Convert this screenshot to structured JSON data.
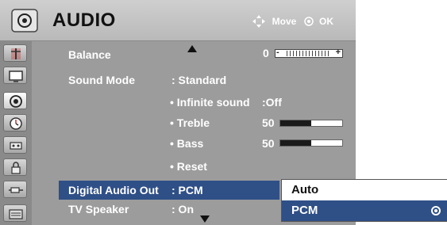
{
  "header": {
    "title": "AUDIO",
    "hint_move": "Move",
    "hint_ok": "OK",
    "header_icon": "speaker-icon"
  },
  "sidebar": {
    "items": [
      {
        "icon": "antenna-icon"
      },
      {
        "icon": "picture-icon"
      },
      {
        "icon": "audio-icon",
        "active": true
      },
      {
        "icon": "clock-icon"
      },
      {
        "icon": "option-icon"
      },
      {
        "icon": "lock-icon"
      },
      {
        "icon": "input-icon"
      },
      {
        "icon": "media-icon"
      }
    ]
  },
  "menu": {
    "balance": {
      "label": "Balance",
      "value": "0"
    },
    "sound_mode": {
      "label": "Sound Mode",
      "value": ": Standard"
    },
    "infinite_sound": {
      "label": "• Infinite sound",
      "value": ":Off"
    },
    "treble": {
      "label": "• Treble",
      "value": "50",
      "level": 0.5
    },
    "bass": {
      "label": "• Bass",
      "value": "50",
      "level": 0.5
    },
    "reset": {
      "label": "• Reset"
    },
    "digital_audio_out": {
      "label": "Digital Audio Out",
      "value": ": PCM"
    },
    "tv_speaker": {
      "label": "TV Speaker",
      "value": ": On"
    }
  },
  "dropdown": {
    "options": [
      {
        "label": "Auto",
        "selected": false
      },
      {
        "label": "PCM",
        "selected": true
      }
    ]
  },
  "colors": {
    "highlight": "#2f4f87",
    "panel": "#9c9c9c"
  }
}
